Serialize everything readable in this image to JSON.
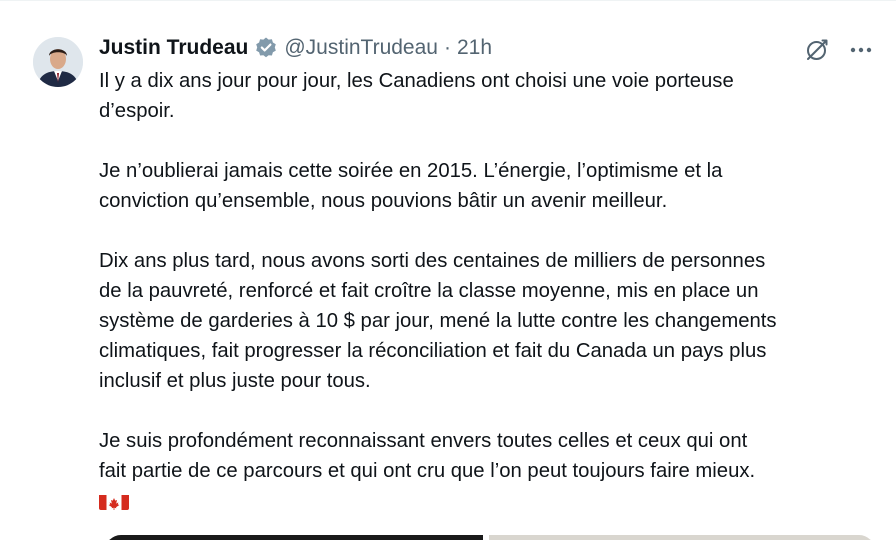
{
  "tweet": {
    "author": {
      "name": "Justin Trudeau",
      "handle": "@JustinTrudeau",
      "separator": "·",
      "time": "21h",
      "avatar_icon": "avatar-photo",
      "verified_icon": "verified-badge-icon",
      "verified_color": "#829aab"
    },
    "actions": {
      "grok_icon": "grok-icon",
      "more_icon": "more-icon"
    },
    "paragraphs": [
      {
        "lines": [
          "Il y a dix ans jour pour jour, les Canadiens ont choisi une voie porteuse",
          "d’espoir."
        ]
      },
      {
        "lines": [
          "Je n’oublierai jamais cette soirée en 2015. L’énergie, l’optimisme et la",
          "conviction qu’ensemble, nous pouvions bâtir un avenir meilleur."
        ]
      },
      {
        "lines": [
          "Dix ans plus tard, nous avons sorti des centaines de milliers de personnes",
          "de la pauvreté, renforcé et fait croître la classe moyenne, mis en place un",
          "système de garderies à 10 $ par jour, mené la lutte contre les changements",
          "climatiques, fait progresser la réconciliation et fait du Canada un pays plus",
          "inclusif et plus juste pour tous."
        ]
      },
      {
        "lines": [
          "Je suis profondément reconnaissant envers toutes celles et ceux qui ont",
          "fait partie de ce parcours et qui ont cru que l’on peut toujours faire mieux."
        ]
      }
    ],
    "emoji": "canada-flag-emoji",
    "colors": {
      "text": "#0f1419",
      "secondary": "#536471",
      "flag_red": "#d52b1e"
    }
  }
}
